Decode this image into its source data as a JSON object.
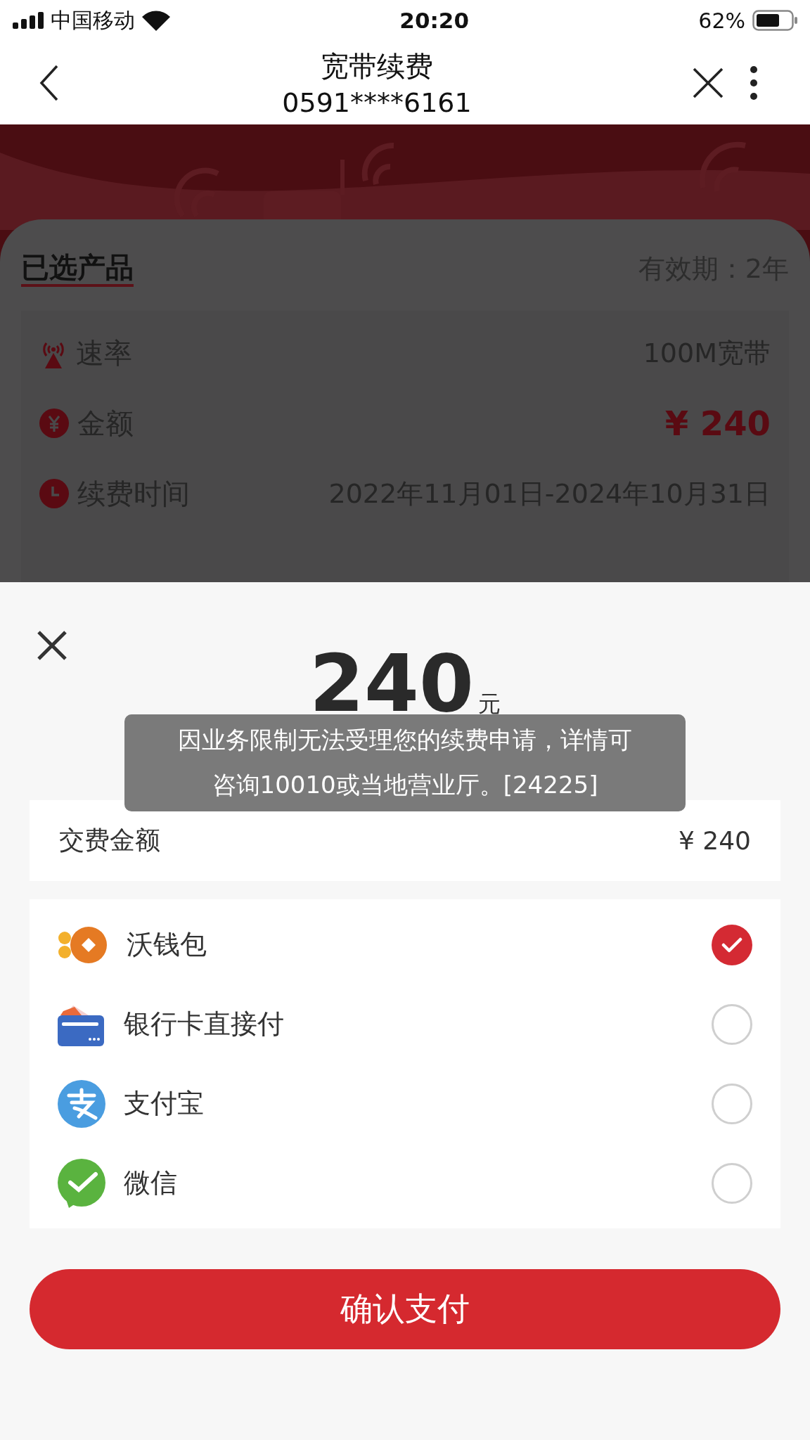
{
  "status_bar": {
    "carrier": "中国移动",
    "time": "20:20",
    "battery": "62%"
  },
  "nav": {
    "title": "宽带续费",
    "subtitle": "0591****6161"
  },
  "product": {
    "heading": "已选产品",
    "validity": "有效期：2年",
    "rows": [
      {
        "kind": "speed",
        "label": "速率",
        "value": "100M宽带"
      },
      {
        "kind": "amount",
        "label": "金额",
        "value": "¥ 240"
      },
      {
        "kind": "period",
        "label": "续费时间",
        "value": "2022年11月01日-2024年10月31日"
      }
    ]
  },
  "sheet": {
    "amount": "240",
    "unit": "元",
    "fee_label": "交费金额",
    "fee_value": "¥ 240",
    "methods": [
      {
        "kind": "wallet",
        "label": "沃钱包",
        "selected": true
      },
      {
        "kind": "bank",
        "label": "银行卡直接付",
        "selected": false
      },
      {
        "kind": "alipay",
        "label": "支付宝",
        "selected": false
      },
      {
        "kind": "wechat",
        "label": "微信",
        "selected": false
      }
    ],
    "confirm": "确认支付"
  },
  "toast": {
    "lines": [
      "因业务限制无法受理您的续费申请，详情可",
      "咨询10010或当地营业厅。[24225]"
    ]
  }
}
